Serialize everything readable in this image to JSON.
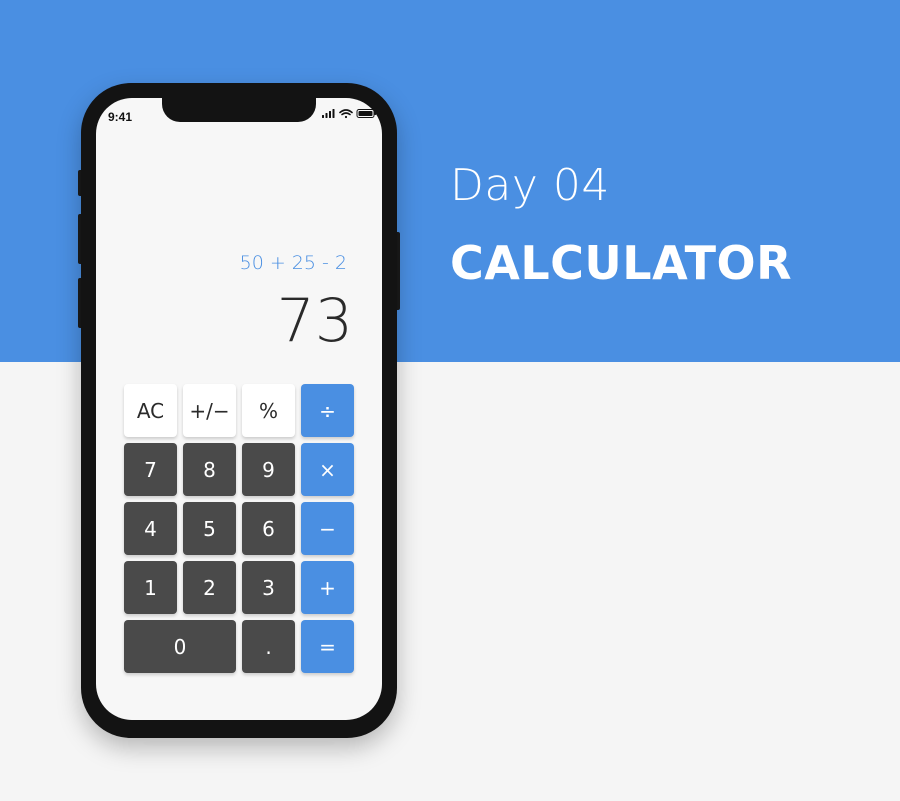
{
  "colors": {
    "accent": "#4a8fe2",
    "background": "#f5f5f5",
    "digit_key": "#4a4a4a",
    "function_key": "#ffffff",
    "phone_frame": "#131313"
  },
  "headline": {
    "day": "Day 04",
    "title": "CALCULATOR"
  },
  "status_bar": {
    "time": "9:41",
    "icons": [
      "signal-icon",
      "wifi-icon",
      "battery-icon"
    ]
  },
  "display": {
    "expression": "50 + 25 - 2",
    "result": "73"
  },
  "keypad": {
    "ac": "AC",
    "plus_minus": "+/−",
    "percent": "%",
    "divide": "÷",
    "seven": "7",
    "eight": "8",
    "nine": "9",
    "multiply": "×",
    "four": "4",
    "five": "5",
    "six": "6",
    "minus": "−",
    "one": "1",
    "two": "2",
    "three": "3",
    "plus": "+",
    "zero": "0",
    "decimal": ".",
    "equals": "="
  }
}
